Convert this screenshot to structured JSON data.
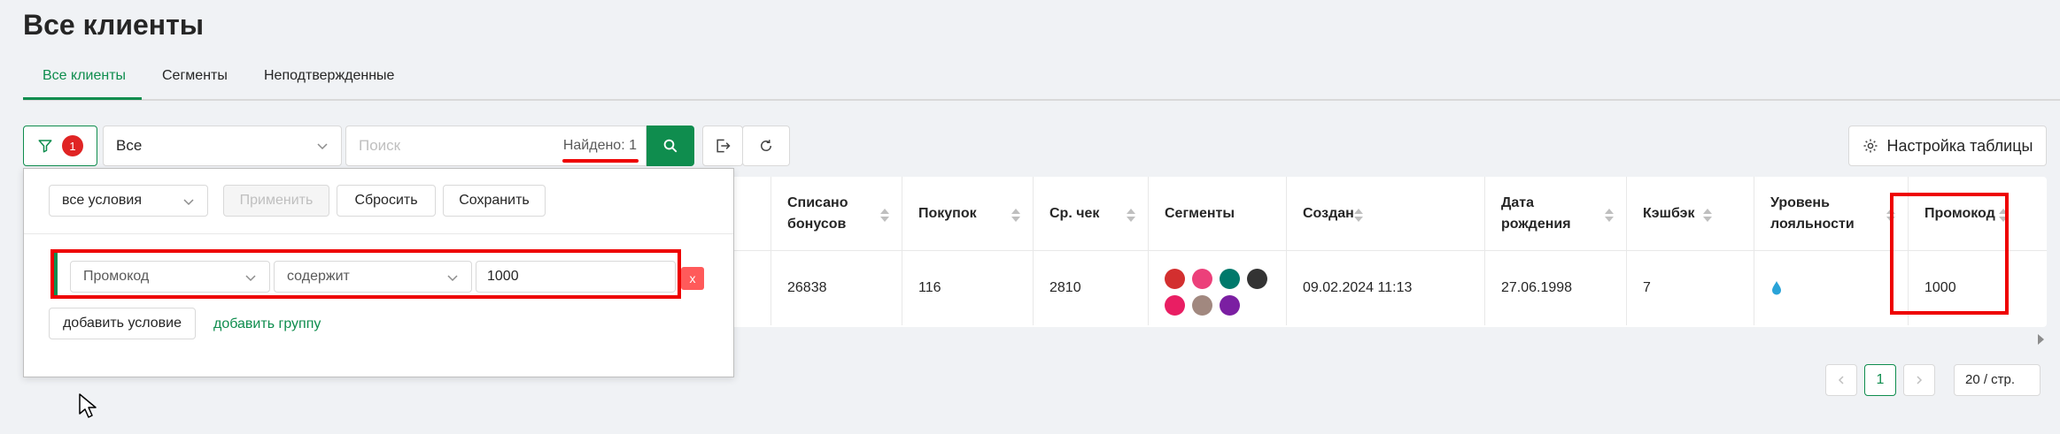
{
  "page": {
    "title": "Все клиенты"
  },
  "tabs": [
    {
      "label": "Все клиенты",
      "active": true
    },
    {
      "label": "Сегменты",
      "active": false
    },
    {
      "label": "Неподтвержденные",
      "active": false
    }
  ],
  "toolbar": {
    "filter_count": "1",
    "segment_select": "Все",
    "search_placeholder": "Поиск",
    "found_text": "Найдено: 1",
    "table_settings_label": "Настройка таблицы"
  },
  "filter_panel": {
    "conditions_mode": "все условия",
    "apply_label": "Применить",
    "reset_label": "Сбросить",
    "save_label": "Сохранить",
    "condition": {
      "field": "Промокод",
      "operator": "содержит",
      "value": "1000",
      "remove_label": "x"
    },
    "add_condition_label": "добавить условие",
    "add_group_label": "добавить группу"
  },
  "table": {
    "columns": [
      {
        "label": "Списано бонусов",
        "sortable": true
      },
      {
        "label": "Покупок",
        "sortable": true
      },
      {
        "label": "Ср. чек",
        "sortable": true
      },
      {
        "label": "Сегменты",
        "sortable": false
      },
      {
        "label": "Создан",
        "sortable": true
      },
      {
        "label": "Дата рождения",
        "sortable": true
      },
      {
        "label": "Кэшбэк",
        "sortable": true
      },
      {
        "label": "Уровень лояльности",
        "sortable": true
      },
      {
        "label": "Промокод",
        "sortable": true
      }
    ],
    "row": {
      "bonuses_spent": "26838",
      "purchases": "116",
      "avg_check": "2810",
      "segment_colors": [
        "#d32f2f",
        "#ec407a",
        "#00796b",
        "#333333",
        "#e91e63",
        "#a1887f",
        "#7b1fa2"
      ],
      "created": "09.02.2024 11:13",
      "birth_date": "27.06.1998",
      "cashback": "7",
      "loyalty_icon": "water-drop-icon",
      "promo_code": "1000"
    }
  },
  "pagination": {
    "current_page": "1",
    "page_size": "20 / стр."
  },
  "colors": {
    "accent": "#0f8d4e",
    "annotation_red": "#ee0000",
    "badge_red": "#e02424"
  }
}
